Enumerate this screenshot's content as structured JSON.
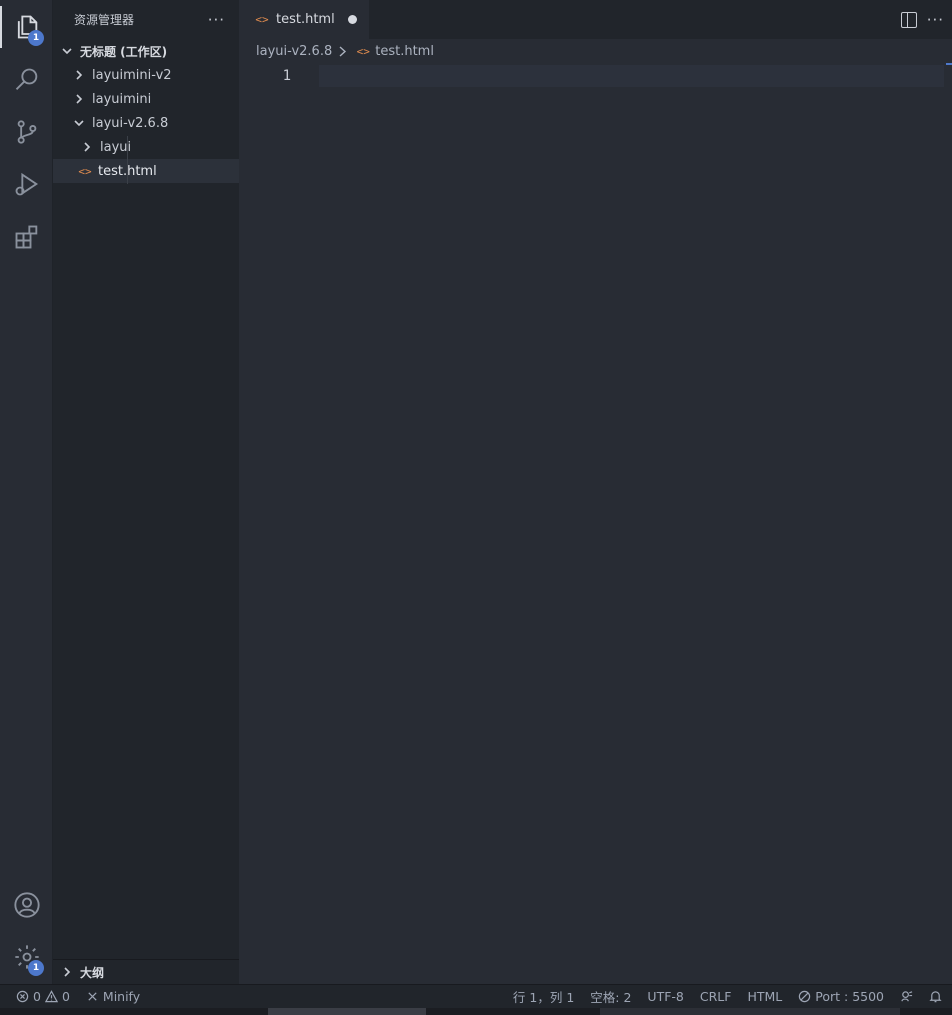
{
  "activity_bar": {
    "explorer_badge": "1",
    "settings_badge": "1"
  },
  "sidebar": {
    "title": "资源管理器",
    "more": "···",
    "workspace": "无标题 (工作区)",
    "tree": [
      {
        "label": "layuimini-v2",
        "expanded": false
      },
      {
        "label": "layuimini",
        "expanded": false
      },
      {
        "label": "layui-v2.6.8",
        "expanded": true
      },
      {
        "label": "layui",
        "expanded": false
      },
      {
        "label": "test.html",
        "selected": true
      }
    ],
    "outline": "大纲"
  },
  "editor": {
    "tab_label": "test.html",
    "tab_more": "···",
    "file_icon": "<>",
    "breadcrumb": [
      "layui-v2.6.8",
      "test.html"
    ],
    "line_numbers": [
      "1"
    ]
  },
  "statusbar": {
    "errors": "0",
    "warnings": "0",
    "minify": "Minify",
    "position": "行 1，列 1",
    "spaces": "空格: 2",
    "encoding": "UTF-8",
    "eol": "CRLF",
    "language": "HTML",
    "port": "Port : 5500"
  },
  "colors": {
    "accent": "#4d78cc",
    "file_icon": "#e08c4f",
    "background": "#282c34",
    "sidebar": "#21252b"
  }
}
